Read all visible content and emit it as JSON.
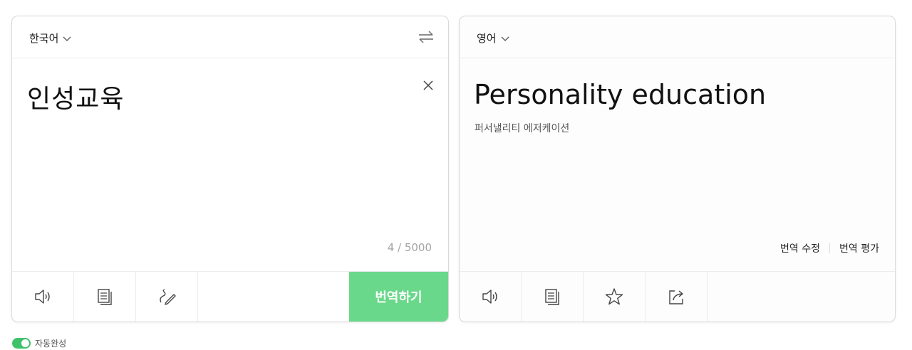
{
  "source": {
    "language": "한국어",
    "text": "인성교육",
    "char_count": "4 / 5000",
    "translate_label": "번역하기",
    "toolbar_icons": [
      "speaker-icon",
      "copy-icon",
      "handwriting-icon"
    ]
  },
  "target": {
    "language": "영어",
    "text": "Personality education",
    "pronunciation": "퍼서낼리티 에저케이션",
    "edit_label": "번역 수정",
    "rate_label": "번역 평가",
    "toolbar_icons": [
      "speaker-icon",
      "copy-icon",
      "star-icon",
      "share-icon"
    ]
  },
  "autocomplete": {
    "label": "자동완성",
    "enabled": true
  },
  "colors": {
    "accent": "#6ad88a",
    "toggle_on": "#3fc36a",
    "border": "#d9d9d9"
  }
}
